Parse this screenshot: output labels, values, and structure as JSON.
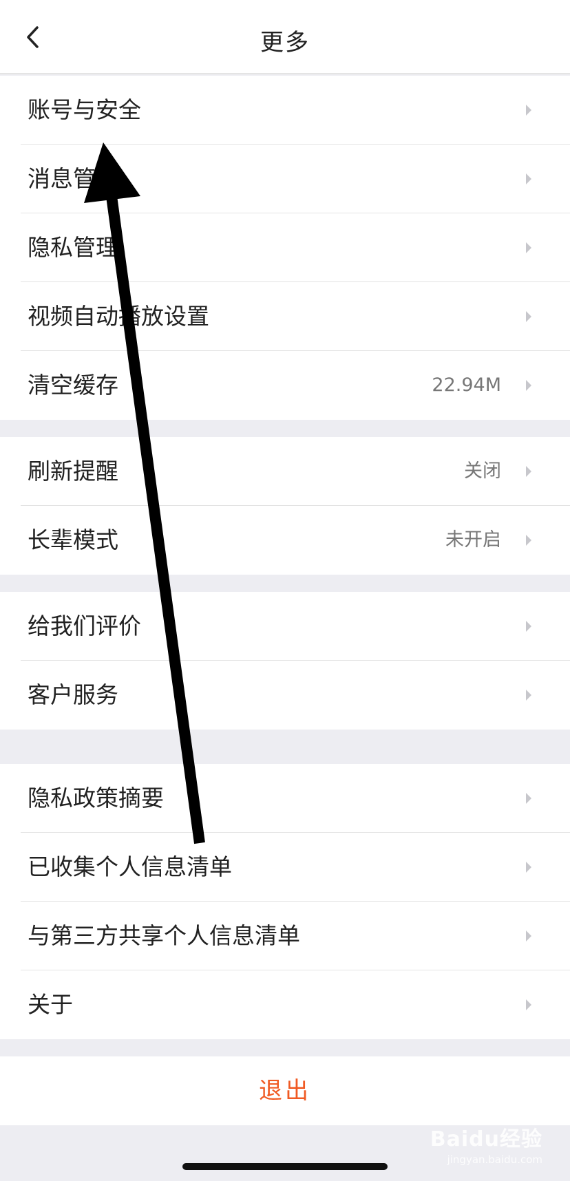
{
  "header": {
    "title": "更多",
    "back_icon": "chevron-left-icon"
  },
  "groups": [
    {
      "items": [
        {
          "label": "账号与安全",
          "value": ""
        },
        {
          "label": "消息管理",
          "value": ""
        },
        {
          "label": "隐私管理",
          "value": ""
        },
        {
          "label": "视频自动播放设置",
          "value": ""
        },
        {
          "label": "清空缓存",
          "value": "22.94M"
        }
      ]
    },
    {
      "items": [
        {
          "label": "刷新提醒",
          "value": "关闭"
        },
        {
          "label": "长辈模式",
          "value": "未开启"
        }
      ]
    },
    {
      "items": [
        {
          "label": "给我们评价",
          "value": ""
        },
        {
          "label": "客户服务",
          "value": ""
        }
      ]
    },
    {
      "items": [
        {
          "label": "隐私政策摘要",
          "value": ""
        },
        {
          "label": "已收集个人信息清单",
          "value": ""
        },
        {
          "label": "与第三方共享个人信息清单",
          "value": ""
        },
        {
          "label": "关于",
          "value": ""
        }
      ]
    }
  ],
  "logout": {
    "label": "退出"
  },
  "watermark": {
    "main": "Baidu经验",
    "sub": "jingyan.baidu.com"
  },
  "colors": {
    "accent": "#f05a23",
    "background": "#ededf2",
    "annotation_arrow": "#000000"
  }
}
